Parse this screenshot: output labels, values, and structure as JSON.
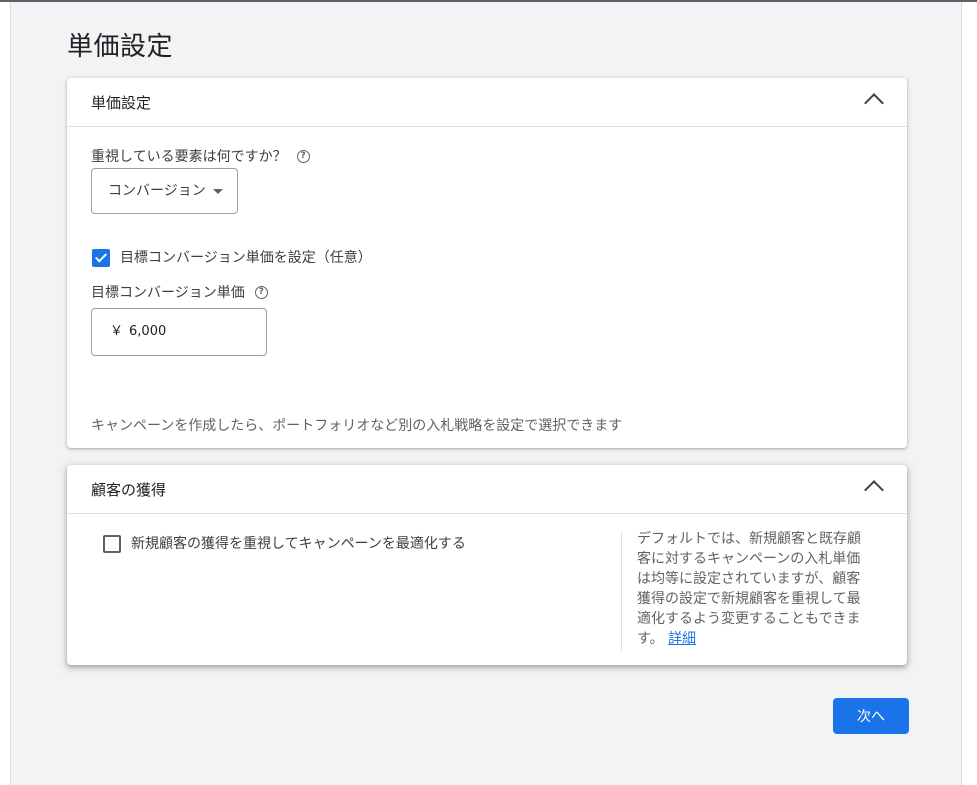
{
  "page": {
    "title": "単価設定"
  },
  "pricing_card": {
    "title": "単価設定",
    "focus_question": "重視している要素は何ですか？",
    "focus_select_value": "コンバージョン",
    "target_cpa_checkbox_label": "目標コンバージョン単価を設定（任意）",
    "target_cpa_checked": true,
    "target_cpa_label": "目標コンバージョン単価",
    "target_cpa_currency": "￥",
    "target_cpa_value": "6,000",
    "note": "キャンペーンを作成したら、ポートフォリオなど別の入札戦略を設定で選択できます"
  },
  "acquisition_card": {
    "title": "顧客の獲得",
    "checkbox_label": "新規顧客の獲得を重視してキャンペーンを最適化する",
    "checked": false,
    "description": "デフォルトでは、新規顧客と既存顧客に対するキャンペーンの入札単価は均等に設定されていますが、顧客獲得の設定で新規顧客を重視して最適化するよう変更することもできます。",
    "learn_more": "詳細"
  },
  "footer": {
    "next_label": "次へ"
  },
  "colors": {
    "accent": "#1a73e8",
    "background": "#f1f3f4"
  },
  "icons": {
    "help": "help-circle-icon",
    "collapse": "chevron-up-icon",
    "dropdown": "caret-down-icon"
  }
}
